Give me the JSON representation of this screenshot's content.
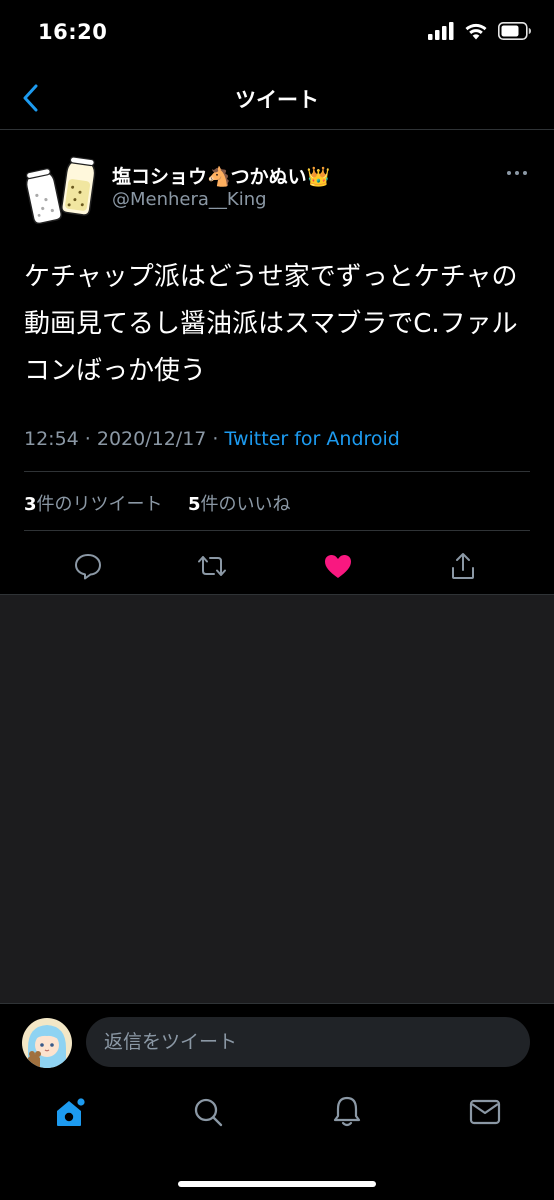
{
  "status_bar": {
    "time": "16:20",
    "icons": [
      "cellular-signal-icon",
      "wifi-icon",
      "battery-icon"
    ]
  },
  "nav": {
    "title": "ツイート",
    "back_icon": "chevron-left-icon"
  },
  "tweet": {
    "author_name": "塩コショウ🐴つかぬい👑",
    "author_handle": "@Menhera__King",
    "text": "ケチャップ派はどうせ家でずっとケチャの動画見てるし醤油派はスマブラでC.ファルコンばっか使う",
    "timestamp": "12:54 · 2020/12/17 · ",
    "source": "Twitter for Android",
    "retweet_count": "3",
    "retweet_label": "件のリツイート",
    "like_count": "5",
    "like_label": "件のいいね",
    "liked": true,
    "actions": [
      "reply-icon",
      "retweet-icon",
      "like-icon",
      "share-icon"
    ]
  },
  "reply": {
    "placeholder": "返信をツイート"
  },
  "tabbar": {
    "tabs": [
      "home-icon",
      "search-icon",
      "notifications-icon",
      "messages-icon"
    ]
  },
  "colors": {
    "background": "#000000",
    "empty_area": "#1c1c1e",
    "accent": "#1d9bf0",
    "like": "#f91880",
    "secondary_text": "#8b98a5",
    "divider": "#2f3336"
  }
}
